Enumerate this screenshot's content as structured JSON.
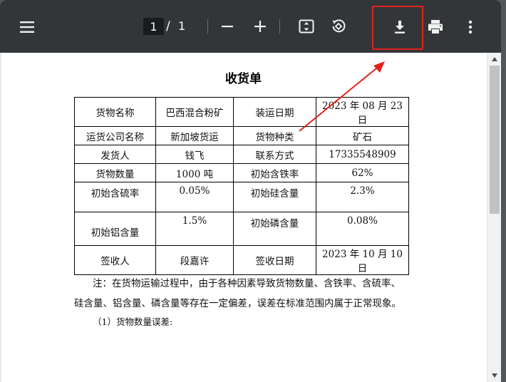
{
  "toolbar": {
    "current_page": "1",
    "page_separator": "/",
    "total_pages": "1",
    "icons": [
      "menu-icon",
      "zoom-out-icon",
      "zoom-in-icon",
      "fit-page-icon",
      "rotate-icon",
      "download-icon",
      "print-icon",
      "more-vert-icon"
    ]
  },
  "document": {
    "title": "收货单",
    "rows": [
      [
        "货物名称",
        "巴西混合粉矿",
        "装运日期",
        "2023 年 08 月 23 日"
      ],
      [
        "运货公司名称",
        "新加坡货运",
        "货物种类",
        "矿石"
      ],
      [
        "发货人",
        "钱飞",
        "联系方式",
        "17335548909"
      ],
      [
        "货物数量",
        "1000 吨",
        "初始含铁率",
        "62%"
      ],
      [
        "初始含硫率",
        "0.05%",
        "初始硅含量",
        "2.3%"
      ],
      [
        "初始铝含量",
        "1.5%",
        "初始磷含量",
        "0.08%"
      ],
      [
        "签收人",
        "段嘉许",
        "签收日期",
        "2023 年 10 月 10 日"
      ]
    ],
    "note_line1": "注：在货物运输过程中，由于各种因素导致货物数量、含铁率、含硫率、",
    "note_line2": "硅含量、铝含量、磷含量等存在一定偏差，误差在标准范围内属于正常现象。",
    "note_item1": "（1）货物数量误差:"
  },
  "colors": {
    "toolbar_bg": "#323639",
    "highlight": "#e2231a"
  }
}
